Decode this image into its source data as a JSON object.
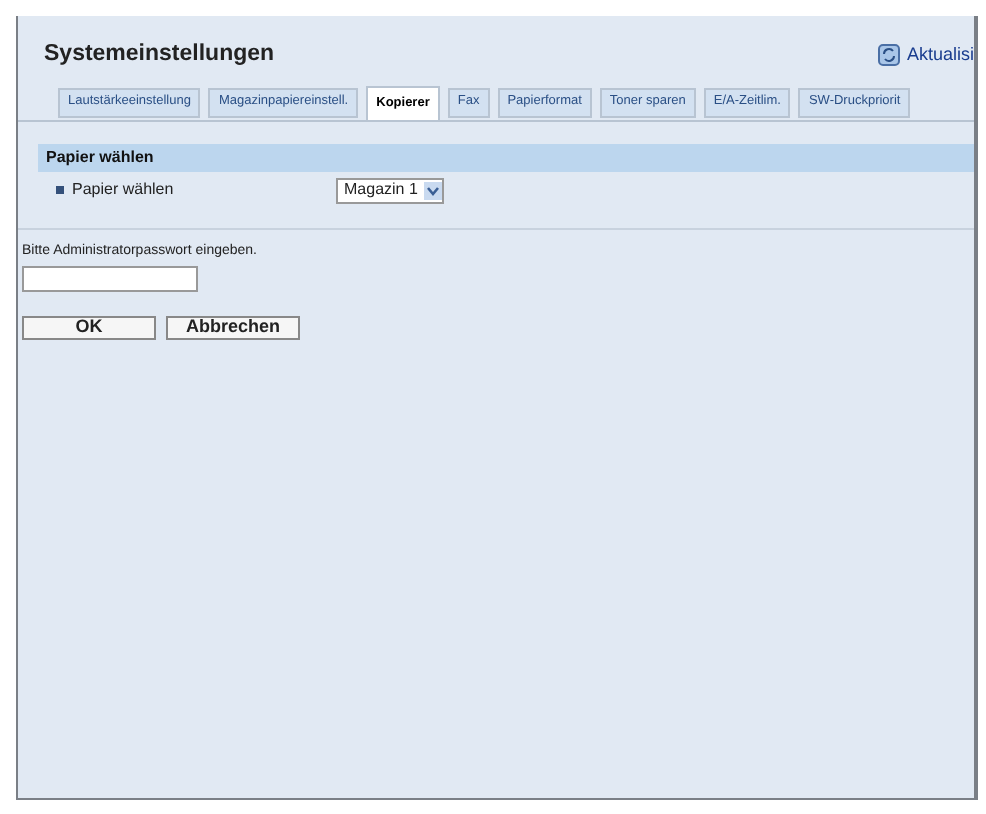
{
  "page_title": "Systemeinstellungen",
  "refresh_link": "Aktualisi",
  "tabs": [
    {
      "label": "Lautstärkeeinstellung",
      "selected": false
    },
    {
      "label": "Magazinpapiereinstell.",
      "selected": false
    },
    {
      "label": "Kopierer",
      "selected": true
    },
    {
      "label": "Fax",
      "selected": false
    },
    {
      "label": "Papierformat",
      "selected": false
    },
    {
      "label": "Toner sparen",
      "selected": false
    },
    {
      "label": "E/A-Zeitlim.",
      "selected": false
    },
    {
      "label": "SW-Druckpriorit",
      "selected": false
    }
  ],
  "section": {
    "title": "Papier wählen",
    "rows": [
      {
        "label": "Papier wählen",
        "value": "Magazin 1"
      }
    ]
  },
  "password_prompt": "Bitte Administratorpasswort eingeben.",
  "buttons": [
    "OK",
    "Abbrechen"
  ]
}
